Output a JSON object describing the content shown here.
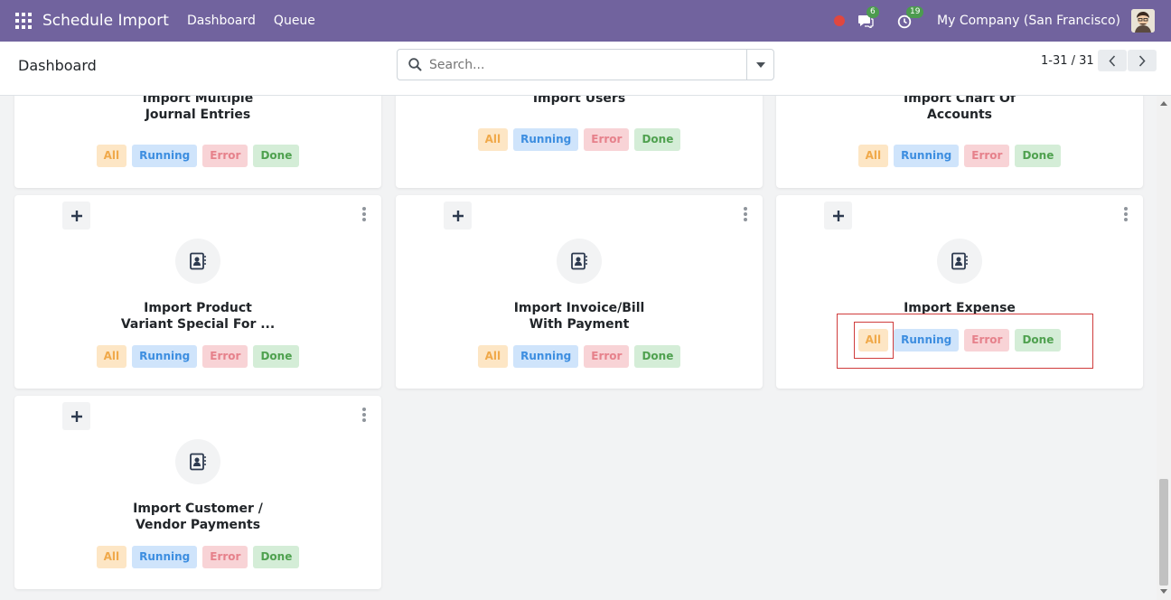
{
  "navbar": {
    "app_title": "Schedule Import",
    "menu": [
      {
        "label": "Dashboard"
      },
      {
        "label": "Queue"
      }
    ],
    "messages_count": "6",
    "activities_count": "19",
    "company": "My Company (San Francisco)",
    "accent": "#71639e"
  },
  "control_panel": {
    "page_title": "Dashboard",
    "search_placeholder": "Search...",
    "pager_value": "1-31 / 31"
  },
  "badges": {
    "all": "All",
    "running": "Running",
    "error": "Error",
    "done": "Done"
  },
  "cards": [
    {
      "title_line1": "Import Multiple",
      "title_line2": "Journal Entries"
    },
    {
      "title_line1": "Import Users",
      "title_line2": ""
    },
    {
      "title_line1": "Import Chart Of",
      "title_line2": "Accounts"
    },
    {
      "title_line1": "Import Product",
      "title_line2": "Variant Special For ..."
    },
    {
      "title_line1": "Import Invoice/Bill",
      "title_line2": "With Payment"
    },
    {
      "title_line1": "Import Expense",
      "title_line2": ""
    },
    {
      "title_line1": "Import Customer /",
      "title_line2": "Vendor Payments"
    }
  ]
}
